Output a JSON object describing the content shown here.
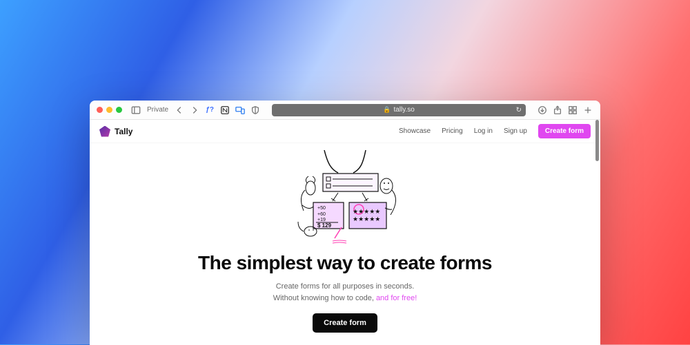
{
  "browser": {
    "private_label": "Private",
    "url": "tally.so"
  },
  "nav": {
    "brand": "Tally",
    "links": {
      "showcase": "Showcase",
      "pricing": "Pricing",
      "login": "Log in",
      "signup": "Sign up"
    },
    "cta": "Create form"
  },
  "hero": {
    "headline": "The simplest way to create forms",
    "sub_line1": "Create forms for all purposes in seconds.",
    "sub_line2_a": "Without knowing how to code, ",
    "sub_line2_b": "and for free!",
    "primary_cta": "Create form"
  },
  "illustration_notes": {
    "calc_values": [
      "+50",
      "+60",
      "+19",
      "$ 129"
    ]
  }
}
